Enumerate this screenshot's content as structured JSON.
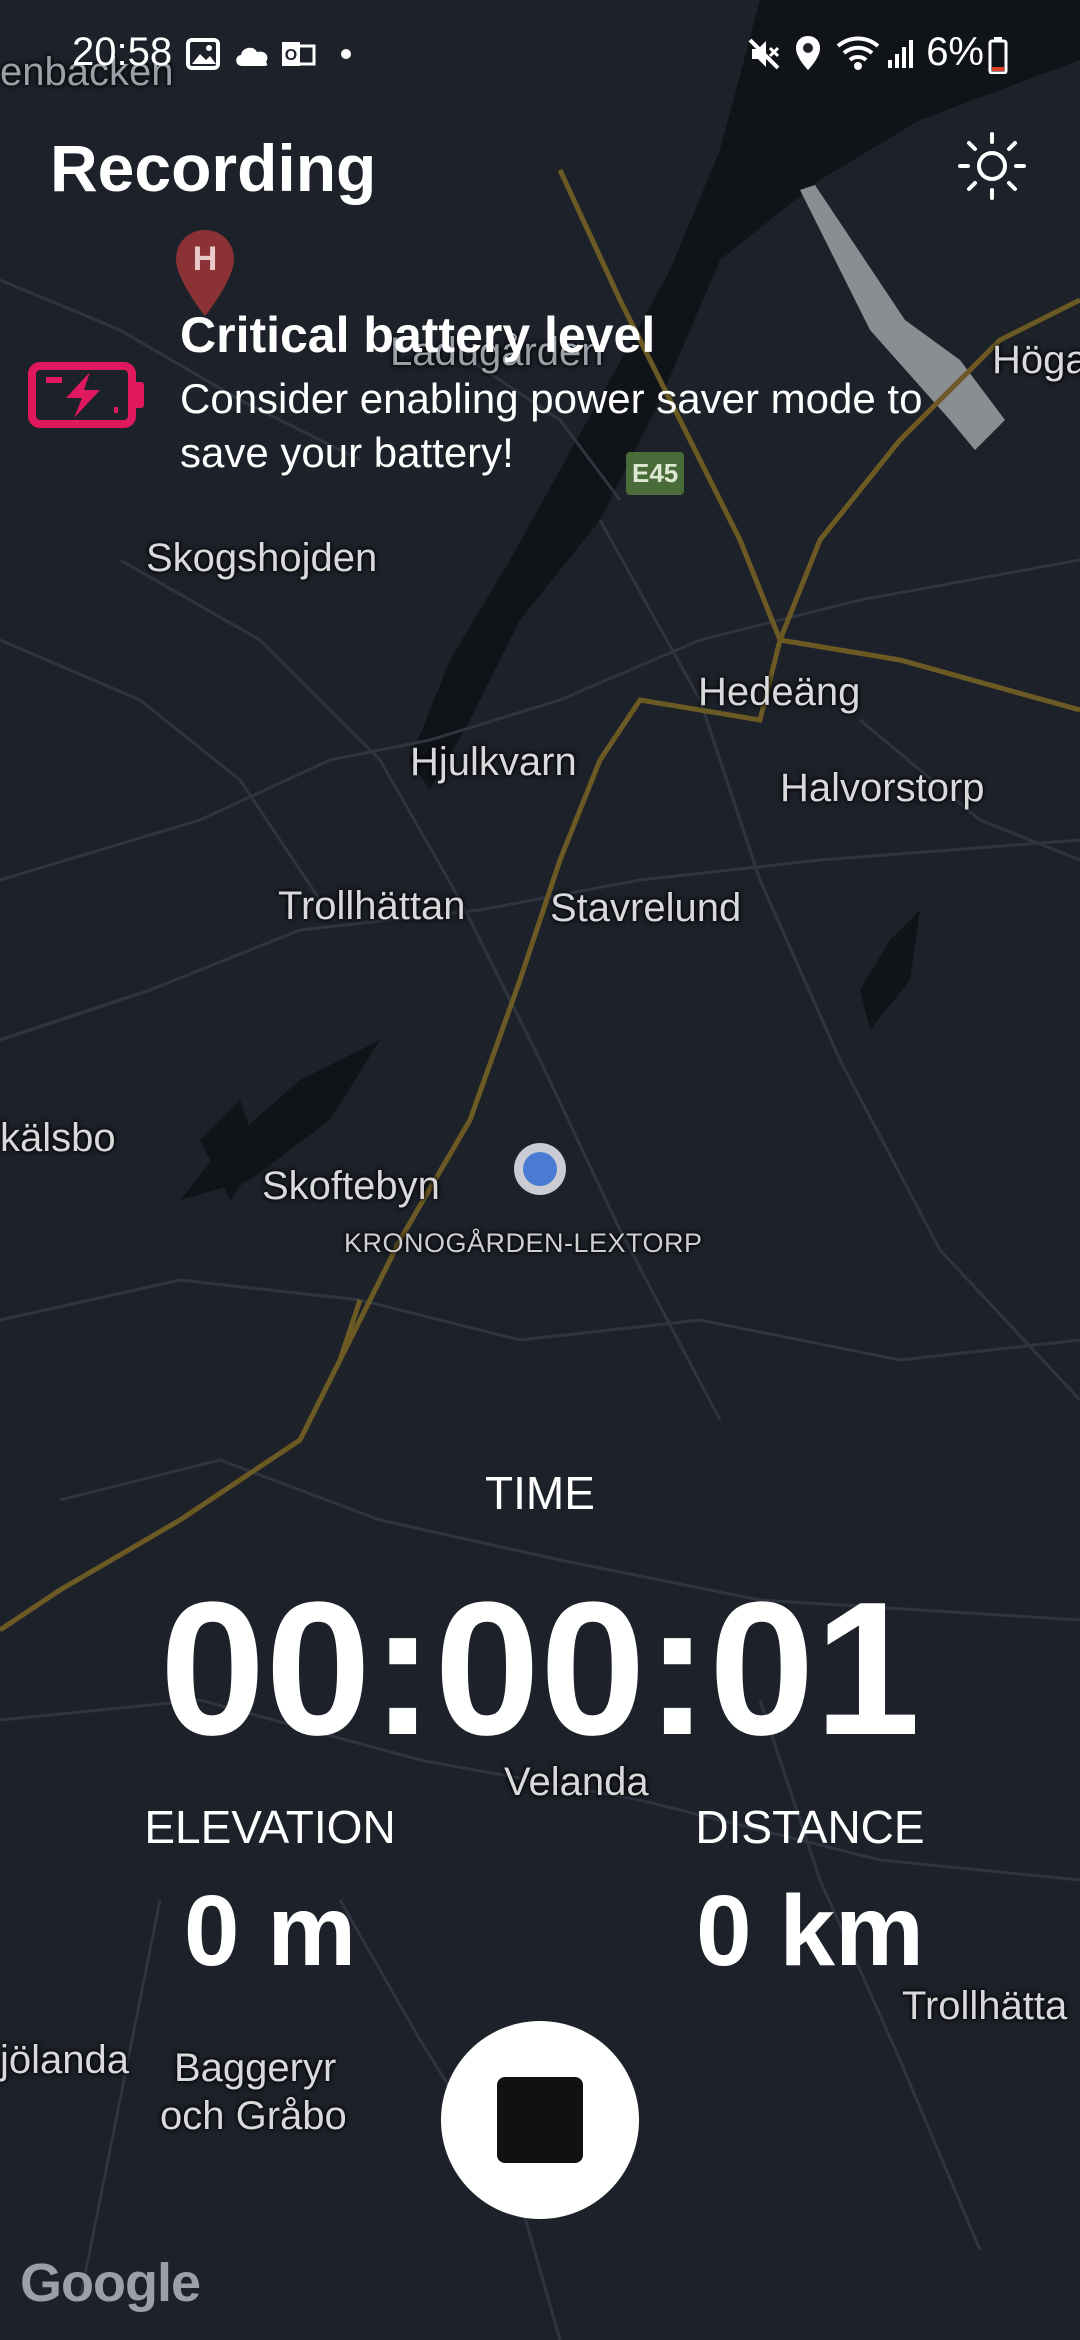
{
  "status_bar": {
    "time": "20:58",
    "battery_percent": "6%",
    "icons": [
      "image-icon",
      "cloud-icon",
      "outlook-icon",
      "dot-icon",
      "mute-icon",
      "location-icon",
      "wifi-icon",
      "signal-icon",
      "battery-icon"
    ]
  },
  "header": {
    "title": "Recording"
  },
  "alert": {
    "title": "Critical battery level",
    "body": "Consider enabling power saver mode to save your battery!",
    "icon": "battery-charging-icon",
    "icon_color": "#e0185d"
  },
  "map": {
    "places": [
      {
        "id": "enbacken",
        "name": "enbacken"
      },
      {
        "id": "ladugarden",
        "name": "Ladugården"
      },
      {
        "id": "hoga",
        "name": "Höga"
      },
      {
        "id": "skogshojden",
        "name": "Skogshojden"
      },
      {
        "id": "hedeang",
        "name": "Hedeäng"
      },
      {
        "id": "hjulkvarn",
        "name": "Hjulkvarn"
      },
      {
        "id": "halvorstorp",
        "name": "Halvorstorp"
      },
      {
        "id": "trollhattan",
        "name": "Trollhättan"
      },
      {
        "id": "stavrelund",
        "name": "Stavrelund"
      },
      {
        "id": "kalsbo",
        "name": "kälsbo"
      },
      {
        "id": "skoftebyn",
        "name": "Skoftebyn"
      },
      {
        "id": "kronogarden",
        "name": "KRONOGÅRDEN-LEXTORP"
      },
      {
        "id": "velanda",
        "name": "Velanda"
      },
      {
        "id": "trollhatta2",
        "name": "Trollhätta"
      },
      {
        "id": "sjolanda",
        "name": "jölanda"
      },
      {
        "id": "baggeryr",
        "name": "Baggeryr"
      },
      {
        "id": "grabo",
        "name": "och Gråbo"
      }
    ],
    "road_shield": "E45",
    "attribution": "Google"
  },
  "metrics": {
    "time_label": "TIME",
    "time_value": "00:00:01",
    "elevation_label": "ELEVATION",
    "elevation_value": "0 m",
    "distance_label": "DISTANCE",
    "distance_value": "0 km"
  },
  "controls": {
    "stop_icon": "stop-icon",
    "brightness_icon": "brightness-icon"
  }
}
